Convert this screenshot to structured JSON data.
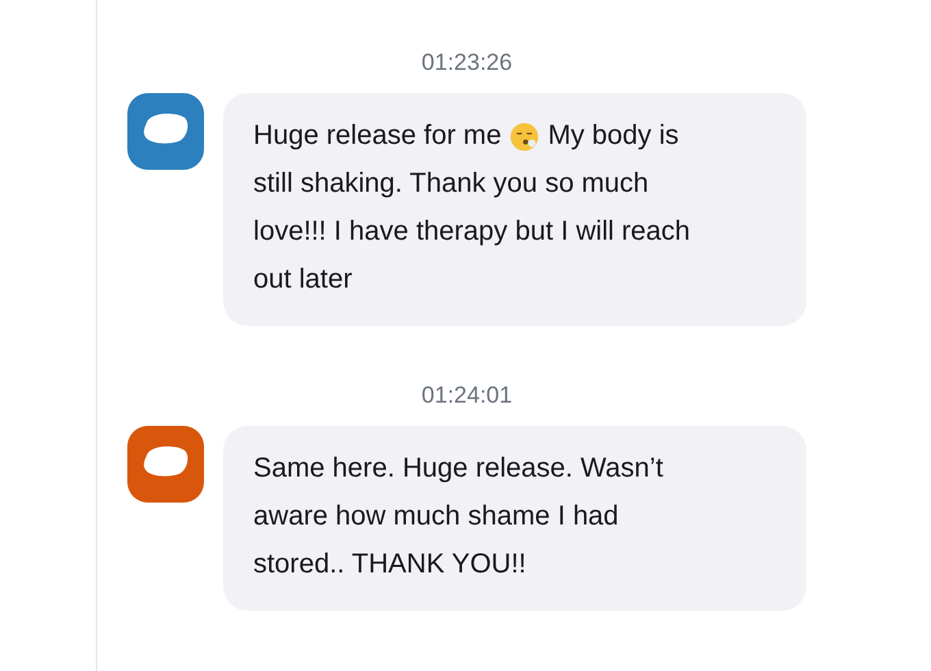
{
  "messages": [
    {
      "time": "01:23:26",
      "color": "#2b80bd",
      "lines": [
        [
          {
            "kind": "text",
            "text": "Huge release for me"
          },
          {
            "kind": "emoji"
          },
          {
            "kind": "text",
            "text": "My body is"
          }
        ],
        [
          {
            "kind": "text",
            "text": "still shaking. Thank you so much"
          }
        ],
        [
          {
            "kind": "text",
            "text": "love!!! I have therapy but I will reach"
          }
        ],
        [
          {
            "kind": "text",
            "text": "out later"
          }
        ]
      ]
    },
    {
      "time": "01:24:01",
      "color": "#d9570d",
      "lines": [
        [
          {
            "kind": "text",
            "text": "Same here. Huge release. Wasn’t"
          }
        ],
        [
          {
            "kind": "text",
            "text": "aware how much shame I had"
          }
        ],
        [
          {
            "kind": "text",
            "text": "stored.. THANK YOU!!"
          }
        ]
      ]
    }
  ]
}
